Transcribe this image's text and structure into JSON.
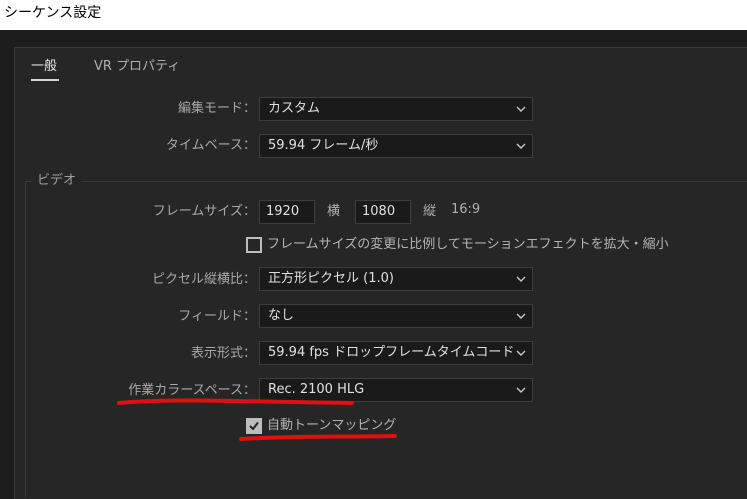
{
  "window": {
    "title": "シーケンス設定"
  },
  "tabs": [
    {
      "label": "一般",
      "active": true
    },
    {
      "label": "VR プロパティ",
      "active": false
    }
  ],
  "general": {
    "edit_mode": {
      "label": "編集モード：",
      "value": "カスタム"
    },
    "timebase": {
      "label": "タイムベース：",
      "value": "59.94  フレーム/秒"
    }
  },
  "video": {
    "group_label": "ビデオ",
    "frame_size": {
      "label": "フレームサイズ：",
      "width": "1920",
      "width_label": "横",
      "height": "1080",
      "height_label": "縦",
      "aspect": "16:9"
    },
    "scale_checkbox": {
      "label": "フレームサイズの変更に比例してモーションエフェクトを拡大・縮小",
      "checked": false
    },
    "pixel_aspect": {
      "label": "ピクセル縦横比：",
      "value": "正方形ピクセル (1.0)"
    },
    "fields": {
      "label": "フィールド：",
      "value": "なし"
    },
    "display_format": {
      "label": "表示形式：",
      "value": "59.94 fps ドロップフレームタイムコード"
    },
    "working_color_space": {
      "label": "作業カラースペース：",
      "value": "Rec. 2100 HLG"
    },
    "tone_mapping": {
      "label": "自動トーンマッピング",
      "checked": true
    }
  },
  "colors": {
    "annotation": "#e01010",
    "panel_bg": "#262626",
    "field_bg": "#1a1a1a"
  },
  "icons": {
    "dropdown": "chevron-down-icon",
    "check": "check-icon"
  }
}
